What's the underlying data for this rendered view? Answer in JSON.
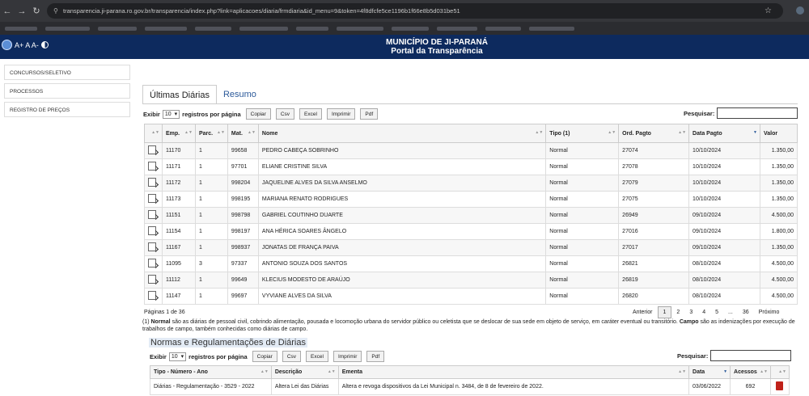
{
  "browser": {
    "url": "transparencia.ji-parana.ro.gov.br/transparencia/index.php?link=aplicacoes/diaria/frmdiaria&id_menu=9&token=4f8dfcfe5ce1196b1f66e8b5d031be51"
  },
  "header": {
    "access": "A+ A A-",
    "title1": "MUNICÍPIO DE JI-PARANÁ",
    "title2": "Portal da Transparência"
  },
  "sidebar": {
    "items": [
      {
        "label": "CONCURSOS/SELETIVO"
      },
      {
        "label": "PROCESSOS"
      },
      {
        "label": "REGISTRO DE PREÇOS"
      }
    ]
  },
  "tabs": [
    {
      "label": "Últimas Diárias"
    },
    {
      "label": "Resumo"
    }
  ],
  "controls": {
    "show": "Exibir",
    "show_value": "10",
    "per_page": "registros por página",
    "buttons": [
      "Copiar",
      "Csv",
      "Excel",
      "Imprimir",
      "Pdf"
    ],
    "search": "Pesquisar:"
  },
  "diarias": {
    "columns": [
      "",
      "Emp.",
      "Parc.",
      "Mat.",
      "Nome",
      "Tipo (1)",
      "Ord. Pagto",
      "Data Pagto",
      "Valor"
    ],
    "rows": [
      [
        "11170",
        "1",
        "99658",
        "PEDRO CABEÇA SOBRINHO",
        "Normal",
        "27074",
        "10/10/2024",
        "1.350,00"
      ],
      [
        "11171",
        "1",
        "97701",
        "ELIANE CRISTINE SILVA",
        "Normal",
        "27078",
        "10/10/2024",
        "1.350,00"
      ],
      [
        "11172",
        "1",
        "998204",
        "JAQUELINE ALVES DA SILVA ANSELMO",
        "Normal",
        "27079",
        "10/10/2024",
        "1.350,00"
      ],
      [
        "11173",
        "1",
        "998195",
        "MARIANA RENATO RODRIGUES",
        "Normal",
        "27075",
        "10/10/2024",
        "1.350,00"
      ],
      [
        "11151",
        "1",
        "998798",
        "GABRIEL COUTINHO DUARTE",
        "Normal",
        "26949",
        "09/10/2024",
        "4.500,00"
      ],
      [
        "11154",
        "1",
        "998197",
        "ANA HÉRICA SOARES ÂNGELO",
        "Normal",
        "27016",
        "09/10/2024",
        "1.800,00"
      ],
      [
        "11167",
        "1",
        "998937",
        "JONATAS DE FRANÇA PAIVA",
        "Normal",
        "27017",
        "09/10/2024",
        "1.350,00"
      ],
      [
        "11095",
        "3",
        "97337",
        "ANTONIO SOUZA DOS SANTOS",
        "Normal",
        "26821",
        "08/10/2024",
        "4.500,00"
      ],
      [
        "11112",
        "1",
        "99649",
        "KLECIUS MODESTO DE ARAÚJO",
        "Normal",
        "26819",
        "08/10/2024",
        "4.500,00"
      ],
      [
        "11147",
        "1",
        "99697",
        "VYVIANE ALVES DA SILVA",
        "Normal",
        "26820",
        "08/10/2024",
        "4.500,00"
      ]
    ]
  },
  "pagination": {
    "info": "Páginas 1 de 36",
    "prev": "Anterior",
    "pages": [
      "1",
      "2",
      "3",
      "4",
      "5",
      "...",
      "36"
    ],
    "next": "Próximo"
  },
  "note": {
    "p1": "(1) ",
    "b1": "Normal",
    "p2": " são as diárias de pessoal civil, cobrindo alimentação, pousada e locomoção urbana do servidor público ou celetista que se deslocar de sua sede em objeto de serviço, em caráter eventual ou transitório. ",
    "b2": "Campo",
    "p3": " são as indenizações por execução de trabalhos de campo, também conhecidas como diárias de campo."
  },
  "normas": {
    "title": "Normas e Regulamentações de Diárias",
    "columns": [
      "Tipo - Número - Ano",
      "Descrição",
      "Ementa",
      "Data",
      "Acessos",
      ""
    ],
    "rows": [
      [
        "Diárias - Regulamentação - 3529 - 2022",
        "Altera Lei das Diárias",
        "Altera e revoga dispositivos da Lei Municipal n. 3484, de 8 de fevereiro de 2022.",
        "03/06/2022",
        "692"
      ]
    ]
  }
}
